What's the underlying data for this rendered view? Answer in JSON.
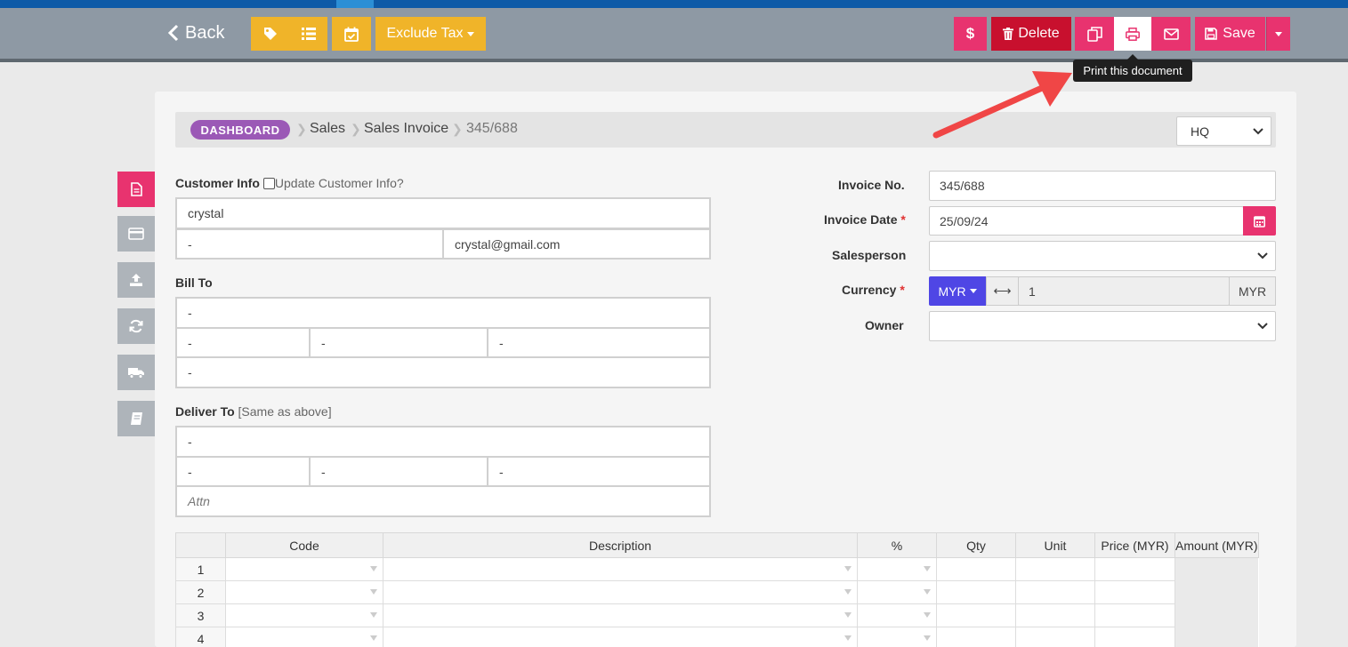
{
  "toolbar": {
    "back_label": "Back",
    "exclude_tax_label": "Exclude Tax",
    "delete_label": "Delete",
    "save_label": "Save",
    "print_tooltip": "Print this document"
  },
  "breadcrumb": {
    "dashboard": "DASHBOARD",
    "sales": "Sales",
    "sales_invoice": "Sales Invoice",
    "current": "345/688"
  },
  "branch": {
    "value": "HQ"
  },
  "customer": {
    "label": "Customer Info",
    "update_label": "Update Customer Info?",
    "name": "crystal",
    "phone": "-",
    "email": "crystal@gmail.com"
  },
  "bill_to": {
    "label": "Bill To",
    "line1": "-",
    "city": "-",
    "state": "-",
    "postcode": "-",
    "country": "-"
  },
  "deliver_to": {
    "label": "Deliver To",
    "same_label": "[Same as above]",
    "line1": "-",
    "city": "-",
    "state": "-",
    "postcode": "-",
    "attn_placeholder": "Attn"
  },
  "invoice": {
    "no_label": "Invoice No.",
    "no_value": "345/688",
    "date_label": "Invoice Date",
    "date_value": "25/09/24",
    "salesperson_label": "Salesperson",
    "salesperson_value": "",
    "currency_label": "Currency",
    "currency_code": "MYR",
    "rate": "1",
    "rate_currency": "MYR",
    "owner_label": "Owner",
    "owner_value": "",
    "required_mark": "*"
  },
  "items_table": {
    "headers": [
      "",
      "Code",
      "Description",
      "%",
      "Qty",
      "Unit",
      "Price (MYR)",
      "Amount (MYR)"
    ],
    "rows": [
      "1",
      "2",
      "3",
      "4"
    ]
  },
  "colors": {
    "pink": "#e8336f",
    "yellow": "#f0b429",
    "delete_red": "#c8102e",
    "purple": "#9b59b6",
    "indigo": "#4f46e5"
  }
}
